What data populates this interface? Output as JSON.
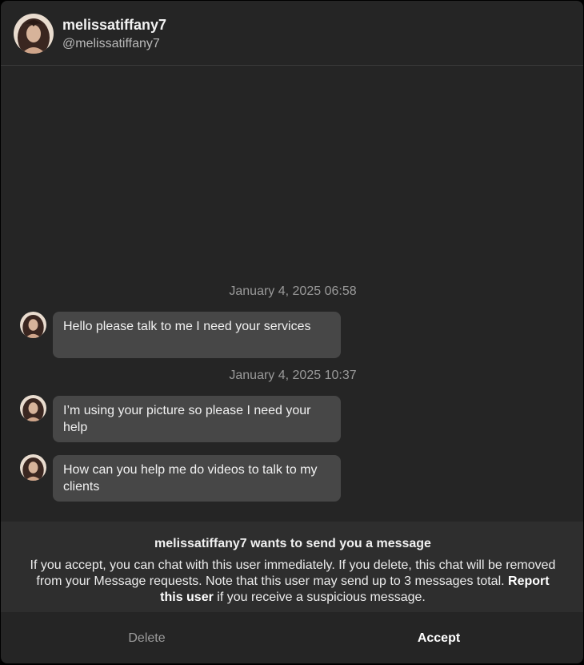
{
  "header": {
    "username": "melissatiffany7",
    "handle": "@melissatiffany7",
    "avatar_icon": "profile-photo"
  },
  "messages": [
    {
      "timestamp": "January 4, 2025 06:58",
      "text": "Hello please talk to me I need your services"
    },
    {
      "timestamp": "January 4, 2025 10:37",
      "text": "I’m using your picture so please I need your help"
    },
    {
      "timestamp": "",
      "text": "How can you help me do videos to talk to my clients"
    }
  ],
  "request": {
    "title": "melissatiffany7 wants to send you a message",
    "body_before": "If you accept, you can chat with this user immediately. If you delete, this chat will be removed from your Message requests. Note that this user may send up to 3 messages total. ",
    "report_link": "Report this user",
    "body_after": " if you receive a suspicious message."
  },
  "actions": {
    "delete_label": "Delete",
    "accept_label": "Accept"
  },
  "colors": {
    "background": "#252525",
    "bubble": "#474747",
    "request_panel": "#2e2e2e",
    "timestamp": "#9a9a9a"
  }
}
